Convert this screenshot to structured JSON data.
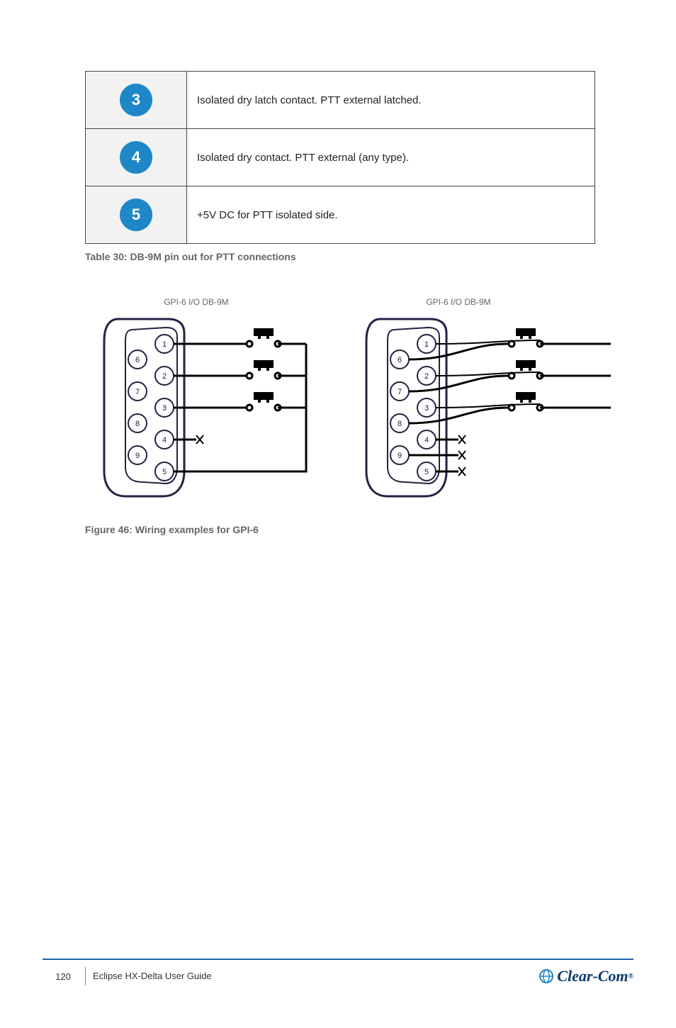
{
  "table": {
    "rows": [
      {
        "num": "3",
        "text": "Isolated dry latch contact. PTT external latched."
      },
      {
        "num": "4",
        "text": "Isolated dry contact. PTT external (any type)."
      },
      {
        "num": "5",
        "text": "+5V DC for PTT isolated side."
      }
    ],
    "caption": "Table 30: DB-9M pin out for PTT connections"
  },
  "figure": {
    "connector_label": "GPI-6 I/O DB-9M",
    "pins": [
      "1",
      "2",
      "3",
      "4",
      "5",
      "6",
      "7",
      "8",
      "9"
    ],
    "caption": "Figure 46: Wiring examples for GPI-6"
  },
  "footer": {
    "page_number": "120",
    "line1": "Eclipse HX-Delta User Guide",
    "brand": "Clear-Com",
    "reg": "®"
  }
}
